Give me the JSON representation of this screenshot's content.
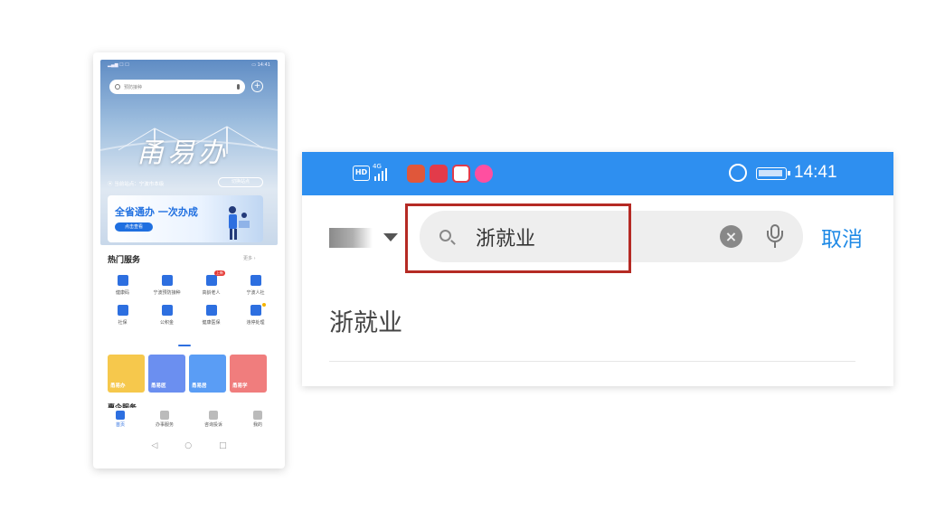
{
  "phone": {
    "search_placeholder": "预防接种",
    "app_logo_text": "甬易办",
    "location_text": "当前站点：宁波市本级",
    "switch_label": "切换站点",
    "banner_title": "全省通办  一次办成",
    "banner_button": "点击查看",
    "hot_services_title": "热门服务",
    "more_label": "更多",
    "services": [
      {
        "label": "健康码",
        "icon": "qr-code-icon"
      },
      {
        "label": "宁波预防接种",
        "icon": "syringe-icon"
      },
      {
        "label": "高龄老人",
        "icon": "elder-icon",
        "badge": "上新"
      },
      {
        "label": "宁波人社",
        "icon": "person-icon"
      },
      {
        "label": "社保",
        "icon": "heart-hands-icon"
      },
      {
        "label": "公积金",
        "icon": "house-icon"
      },
      {
        "label": "健康医保",
        "icon": "medical-icon"
      },
      {
        "label": "违停处理",
        "icon": "car-icon",
        "dot": true
      }
    ],
    "cards": [
      {
        "label": "甬易办",
        "color": "#f6c84c"
      },
      {
        "label": "甬易医",
        "color": "#6b8ff0"
      },
      {
        "label": "甬易居",
        "color": "#5a9df5"
      },
      {
        "label": "甬易学",
        "color": "#f07d7d"
      }
    ],
    "sub_section_title": "惠企服务",
    "nav": [
      {
        "label": "首页",
        "active": true
      },
      {
        "label": "办事服务",
        "active": false
      },
      {
        "label": "咨询投诉",
        "active": false
      },
      {
        "label": "我的",
        "active": false
      }
    ],
    "sys_buttons": [
      "◁",
      "○",
      "□"
    ]
  },
  "zoom": {
    "status_hd": "HD",
    "status_4g": "4G",
    "status_time": "14:41",
    "status_bar_color": "#2e8ff0",
    "search_query": "浙就业",
    "cancel_label": "取消",
    "suggestion": "浙就业",
    "highlight_color": "#b52a24",
    "accent_color": "#1f8ae6"
  }
}
